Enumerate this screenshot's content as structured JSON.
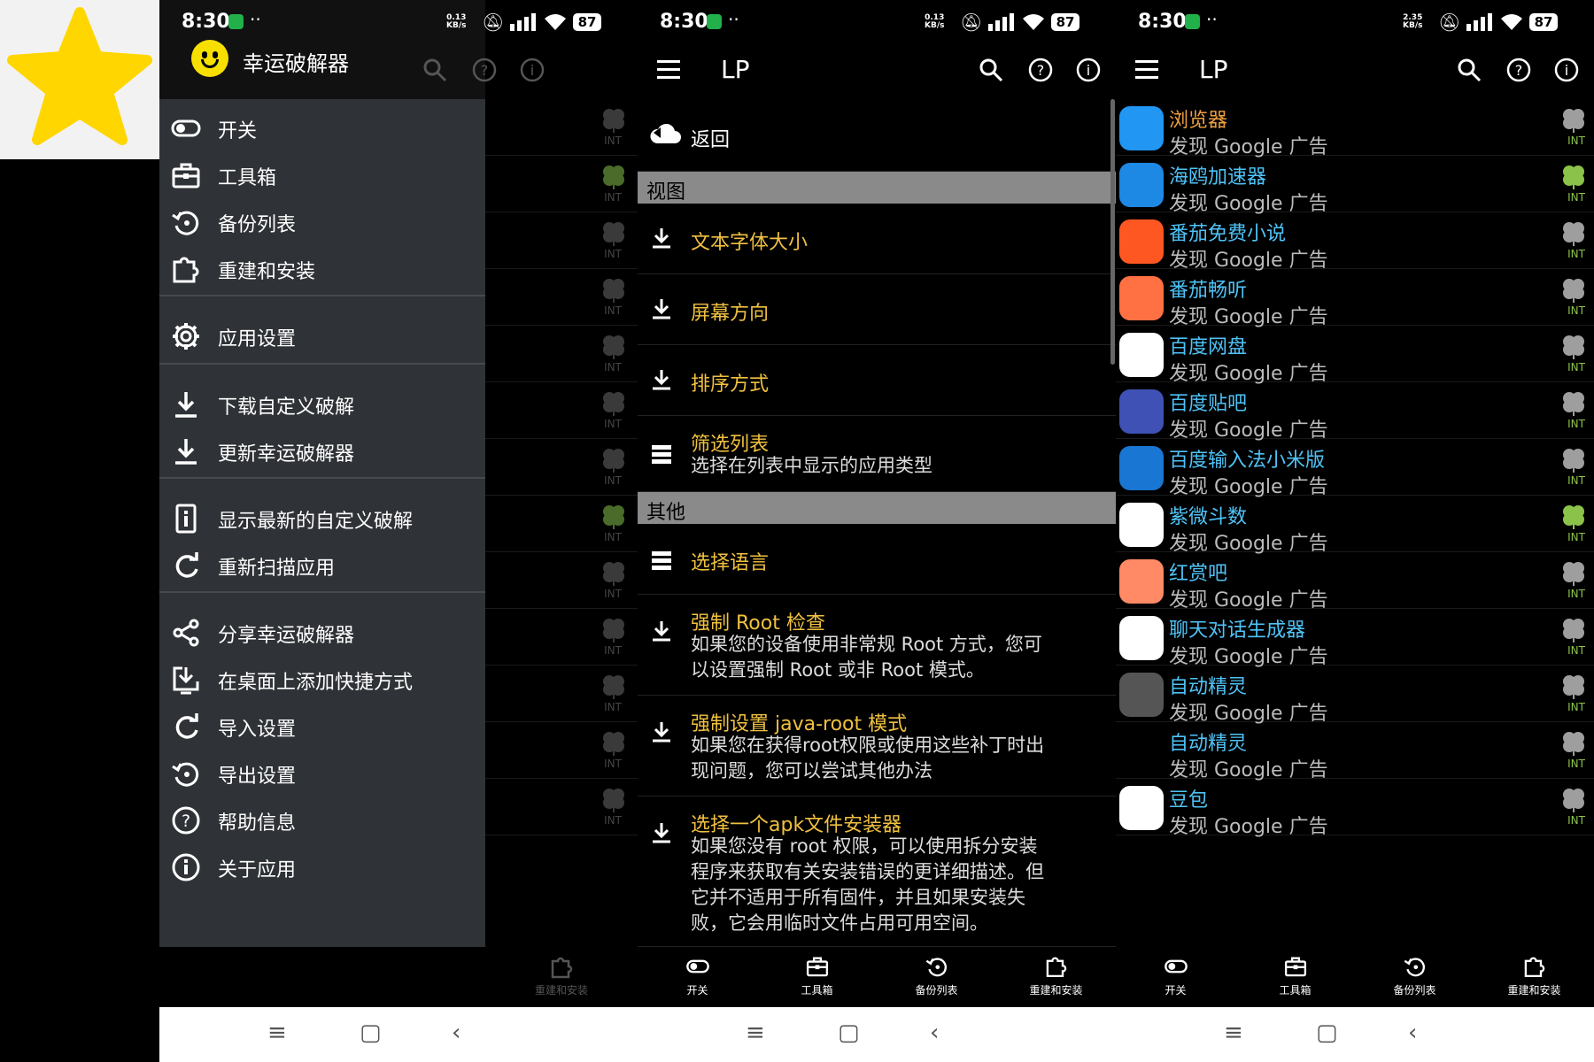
{
  "colors": {
    "accent": "#f0c040",
    "app_name": "#4fc3f7",
    "clover_green": "#8bc34a",
    "drawer_bg": "#2f3236",
    "star": "#ffd600"
  },
  "star_tile": {
    "icon": "star-icon"
  },
  "status": [
    {
      "time": "8:30",
      "kbs_top": "0.13",
      "kbs_bottom": "KB/s",
      "battery": "87"
    },
    {
      "time": "8:30",
      "kbs_top": "0.13",
      "kbs_bottom": "KB/s",
      "battery": "87"
    },
    {
      "time": "8:30",
      "kbs_top": "2.35",
      "kbs_bottom": "KB/s",
      "battery": "87"
    }
  ],
  "drawer": {
    "title": "幸运破解器",
    "items": [
      {
        "label": "开关",
        "icon": "toggle-icon"
      },
      {
        "label": "工具箱",
        "icon": "toolbox-icon"
      },
      {
        "label": "备份列表",
        "icon": "backup-icon"
      },
      {
        "label": "重建和安装",
        "icon": "puzzle-icon"
      },
      {
        "label": "应用设置",
        "icon": "gear-icon"
      },
      {
        "label": "下载自定义破解",
        "icon": "download-icon"
      },
      {
        "label": "更新幸运破解器",
        "icon": "download-icon"
      },
      {
        "label": "显示最新的自定义破解",
        "icon": "info-box-icon"
      },
      {
        "label": "重新扫描应用",
        "icon": "refresh-icon"
      },
      {
        "label": "分享幸运破解器",
        "icon": "share-icon"
      },
      {
        "label": "在桌面上添加快捷方式",
        "icon": "shortcut-icon"
      },
      {
        "label": "导入设置",
        "icon": "refresh-icon"
      },
      {
        "label": "导出设置",
        "icon": "backup-icon"
      },
      {
        "label": "帮助信息",
        "icon": "help-icon"
      },
      {
        "label": "关于应用",
        "icon": "info-icon"
      }
    ],
    "bg_tag": "INT",
    "bg_bottom_label": "重建和安装"
  },
  "settings": {
    "title": "LP",
    "back": "返回",
    "cat_view": "视图",
    "font_size": "文本字体大小",
    "orientation": "屏幕方向",
    "sort": "排序方式",
    "filter": "筛选列表",
    "filter_desc": "选择在列表中显示的应用类型",
    "cat_other": "其他",
    "language": "选择语言",
    "root_title": "强制 Root 检查",
    "root_desc": [
      "如果您的设备使用非常规 Root 方式，您可",
      "以设置强制 Root 或非 Root 模式。"
    ],
    "java_title": "强制设置 java-root 模式",
    "java_desc": [
      "如果您在获得root权限或使用这些补丁时出",
      "现问题，您可以尝试其他办法"
    ],
    "apk_title": "选择一个apk文件安装器",
    "apk_desc": [
      "如果您没有 root 权限，可以使用拆分安装",
      "程序来获取有关安装错误的更详细描述。但",
      "它并不适用于所有固件，并且如果安装失",
      "败，它会用临时文件占用可用空间。"
    ]
  },
  "applist": {
    "title": "LP",
    "desc": "发现 Google 广告",
    "tag": "INT",
    "apps": [
      {
        "name": "浏览器",
        "color": "#f0a040",
        "bg": "#2196f3",
        "green": false
      },
      {
        "name": "海鸥加速器",
        "color": "#4fc3f7",
        "bg": "#1e88e5",
        "green": true
      },
      {
        "name": "番茄免费小说",
        "color": "#4fc3f7",
        "bg": "#ff5722",
        "green": false
      },
      {
        "name": "番茄畅听",
        "color": "#4fc3f7",
        "bg": "#ff7043",
        "green": false
      },
      {
        "name": "百度网盘",
        "color": "#4fc3f7",
        "bg": "#ffffff",
        "green": false
      },
      {
        "name": "百度贴吧",
        "color": "#4fc3f7",
        "bg": "#3f51b5",
        "green": false
      },
      {
        "name": "百度输入法小米版",
        "color": "#4fc3f7",
        "bg": "#1976d2",
        "green": false
      },
      {
        "name": "紫微斗数",
        "color": "#4fc3f7",
        "bg": "#ffffff",
        "green": true
      },
      {
        "name": "红赏吧",
        "color": "#4fc3f7",
        "bg": "#ff8a65",
        "green": false
      },
      {
        "name": "聊天对话生成器",
        "color": "#4fc3f7",
        "bg": "#ffffff",
        "green": false
      },
      {
        "name": "自动精灵",
        "color": "#4fc3f7",
        "bg": "#555555",
        "green": false
      },
      {
        "name": "自动精灵",
        "color": "#4fc3f7",
        "bg": "#000000",
        "green": false
      },
      {
        "name": "豆包",
        "color": "#4fc3f7",
        "bg": "#ffffff",
        "green": false
      }
    ]
  },
  "bottomnav": [
    {
      "label": "开关",
      "icon": "toggle-icon"
    },
    {
      "label": "工具箱",
      "icon": "toolbox-icon"
    },
    {
      "label": "备份列表",
      "icon": "backup-icon"
    },
    {
      "label": "重建和安装",
      "icon": "puzzle-icon"
    }
  ],
  "sysnav": {
    "menu": "≡",
    "home": "▢",
    "back": "‹"
  }
}
